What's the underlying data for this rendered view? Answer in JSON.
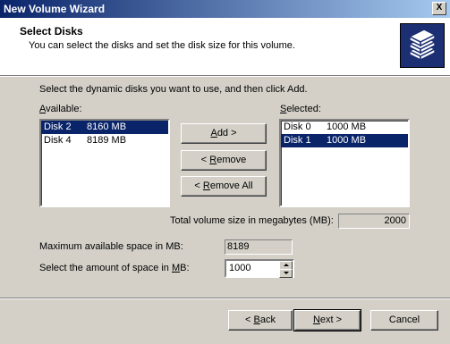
{
  "window": {
    "title": "New Volume Wizard",
    "close_label": "X"
  },
  "header": {
    "title": "Select Disks",
    "subtitle": "You can select the disks and set the disk size for this volume.",
    "icon": "stacked-disks-icon"
  },
  "instructions": "Select the dynamic disks you want to use, and then click Add.",
  "available": {
    "label_a": "A",
    "label_rest": "vailable:",
    "items": [
      {
        "disk": "Disk 2",
        "size": "8160 MB",
        "selected": true
      },
      {
        "disk": "Disk 4",
        "size": "8189 MB",
        "selected": false
      }
    ]
  },
  "selected": {
    "label_pre": "S",
    "label_rest": "elected:",
    "items": [
      {
        "disk": "Disk 0",
        "size": "1000 MB",
        "selected": false
      },
      {
        "disk": "Disk 1",
        "size": "1000 MB",
        "selected": true
      }
    ]
  },
  "buttons": {
    "add_mn": "A",
    "add_rest": "dd >",
    "remove_pre": "< ",
    "remove_mn": "R",
    "remove_rest": "emove",
    "remove_all_pre": "< ",
    "remove_all_mn": "R",
    "remove_all_rest": "emove All"
  },
  "total": {
    "label": "Total volume size in megabytes (MB):",
    "value": "2000"
  },
  "max_space": {
    "label": "Maximum available space in MB:",
    "value": "8189"
  },
  "amount": {
    "label_pre": "Select the amount of space in ",
    "label_mn": "M",
    "label_rest": "B:",
    "value": "1000"
  },
  "nav": {
    "back_pre": "< ",
    "back_mn": "B",
    "back_rest": "ack",
    "next_mn": "N",
    "next_rest": "ext >",
    "cancel": "Cancel"
  }
}
